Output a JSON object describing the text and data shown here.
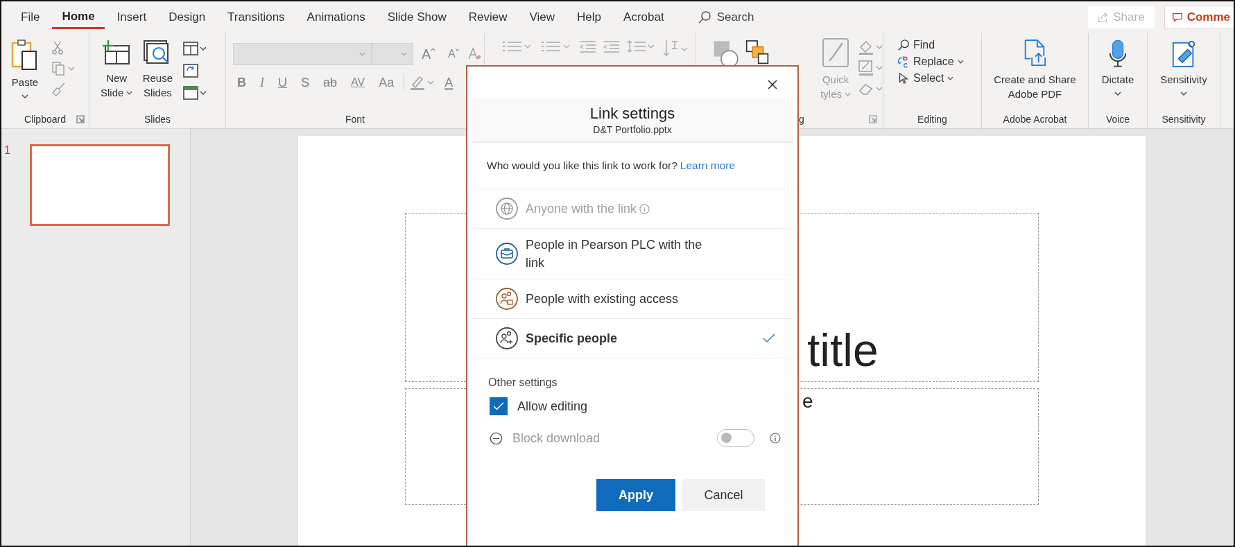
{
  "tabs": [
    {
      "label": "File",
      "selected": false
    },
    {
      "label": "Home",
      "selected": true
    },
    {
      "label": "Insert",
      "selected": false
    },
    {
      "label": "Design",
      "selected": false
    },
    {
      "label": "Transitions",
      "selected": false
    },
    {
      "label": "Animations",
      "selected": false
    },
    {
      "label": "Slide Show",
      "selected": false
    },
    {
      "label": "Review",
      "selected": false
    },
    {
      "label": "View",
      "selected": false
    },
    {
      "label": "Help",
      "selected": false
    },
    {
      "label": "Acrobat",
      "selected": false
    }
  ],
  "search": {
    "placeholder": "Search"
  },
  "share_button": {
    "label": "Share",
    "disabled": true
  },
  "comments_button": {
    "label": "Comme"
  },
  "ribbon": {
    "clipboard": {
      "label": "Clipboard",
      "paste": "Paste"
    },
    "slides": {
      "label": "Slides",
      "new_slide": [
        "New",
        "Slide"
      ],
      "reuse_slides": [
        "Reuse",
        "Slides"
      ]
    },
    "font": {
      "label": "Font",
      "grow": "Aˆ",
      "shrink": "Aˇ",
      "bold": "B",
      "italic": "I",
      "underline": "U",
      "shadow": "S",
      "strikethrough": "ab",
      "spacing": "AV",
      "case": "Aa",
      "font_color_label": "A"
    },
    "drawing": {
      "quick_styles": [
        "Quick",
        "tyles"
      ],
      "label_fragment": "g"
    },
    "editing": {
      "label": "Editing",
      "find": "Find",
      "replace": "Replace",
      "select": "Select"
    },
    "acrobat": {
      "label": "Adobe Acrobat",
      "create": [
        "Create and Share",
        "Adobe PDF"
      ]
    },
    "voice": {
      "label": "Voice",
      "dictate": "Dictate"
    },
    "sensitivity": {
      "label": "Sensitivity",
      "button": "Sensitivity"
    }
  },
  "slides": [
    {
      "number": "1",
      "selected": true
    }
  ],
  "slide": {
    "title_fragment": "title",
    "subtitle_fragment": "e"
  },
  "dialog": {
    "title": "Link settings",
    "file": "D&T Portfolio.pptx",
    "question": "Who would you like this link to work for?",
    "learn_more": "Learn more",
    "options": [
      {
        "label": "Anyone with the link",
        "kind": "anyone",
        "disabled": true,
        "info": true,
        "selected": false
      },
      {
        "label": "People in Pearson PLC with the link",
        "kind": "organization",
        "disabled": false,
        "info": false,
        "selected": false
      },
      {
        "label": "People with existing access",
        "kind": "existing",
        "disabled": false,
        "info": false,
        "selected": false
      },
      {
        "label": "Specific people",
        "kind": "specific",
        "disabled": false,
        "info": false,
        "selected": true
      }
    ],
    "other_settings": "Other settings",
    "allow_editing": {
      "label": "Allow editing",
      "checked": true
    },
    "block_download": {
      "label": "Block download",
      "on": false,
      "disabled": true
    },
    "apply": "Apply",
    "cancel": "Cancel"
  }
}
